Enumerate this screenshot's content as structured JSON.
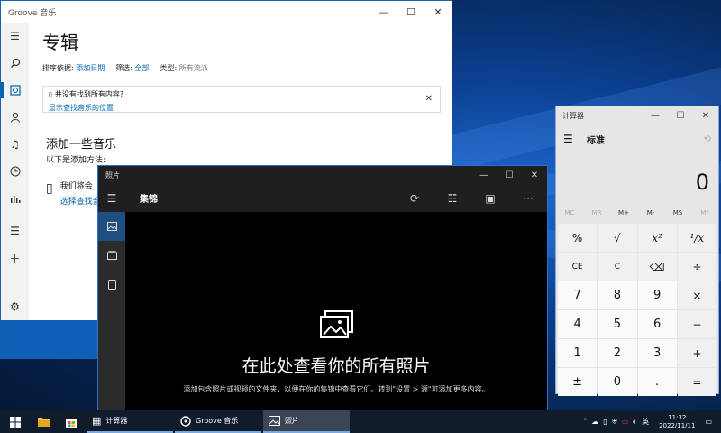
{
  "groove": {
    "title": "Groove 音乐",
    "heading": "专辑",
    "sort_label": "排序依据:",
    "sort_value": "添加日期",
    "filter_label": "筛选:",
    "filter_value": "全部",
    "type_label": "类型:",
    "type_value": "所有流派",
    "notice_line1": "并没有找到所有内容?",
    "notice_link": "显示查找音乐的位置",
    "add_heading": "添加一些音乐",
    "add_sub": "以下是添加方法:",
    "partial_line1": "我们将会",
    "partial_line2": "选择查找音"
  },
  "photos": {
    "title": "照片",
    "collection": "集锦",
    "empty_title": "在此处查看你的所有照片",
    "empty_sub": "添加包含照片或视频的文件夹，以便在你的集锦中查看它们。转到\"设置 > 源\"可添加更多内容。"
  },
  "calculator": {
    "title": "计算器",
    "mode": "标准",
    "display": "0",
    "memory": [
      "MC",
      "MR",
      "M+",
      "M-",
      "MS",
      "M*"
    ],
    "keys": [
      "%",
      "√",
      "x²",
      "¹/x",
      "CE",
      "C",
      "⌫",
      "÷",
      "7",
      "8",
      "9",
      "×",
      "4",
      "5",
      "6",
      "−",
      "1",
      "2",
      "3",
      "+",
      "±",
      "0",
      ".",
      "="
    ]
  },
  "taskbar": {
    "apps": [
      {
        "label": "计算器"
      },
      {
        "label": "Groove 音乐"
      },
      {
        "label": "照片"
      }
    ],
    "ime": "英",
    "time": "11:32",
    "date": "2022/11/11"
  }
}
